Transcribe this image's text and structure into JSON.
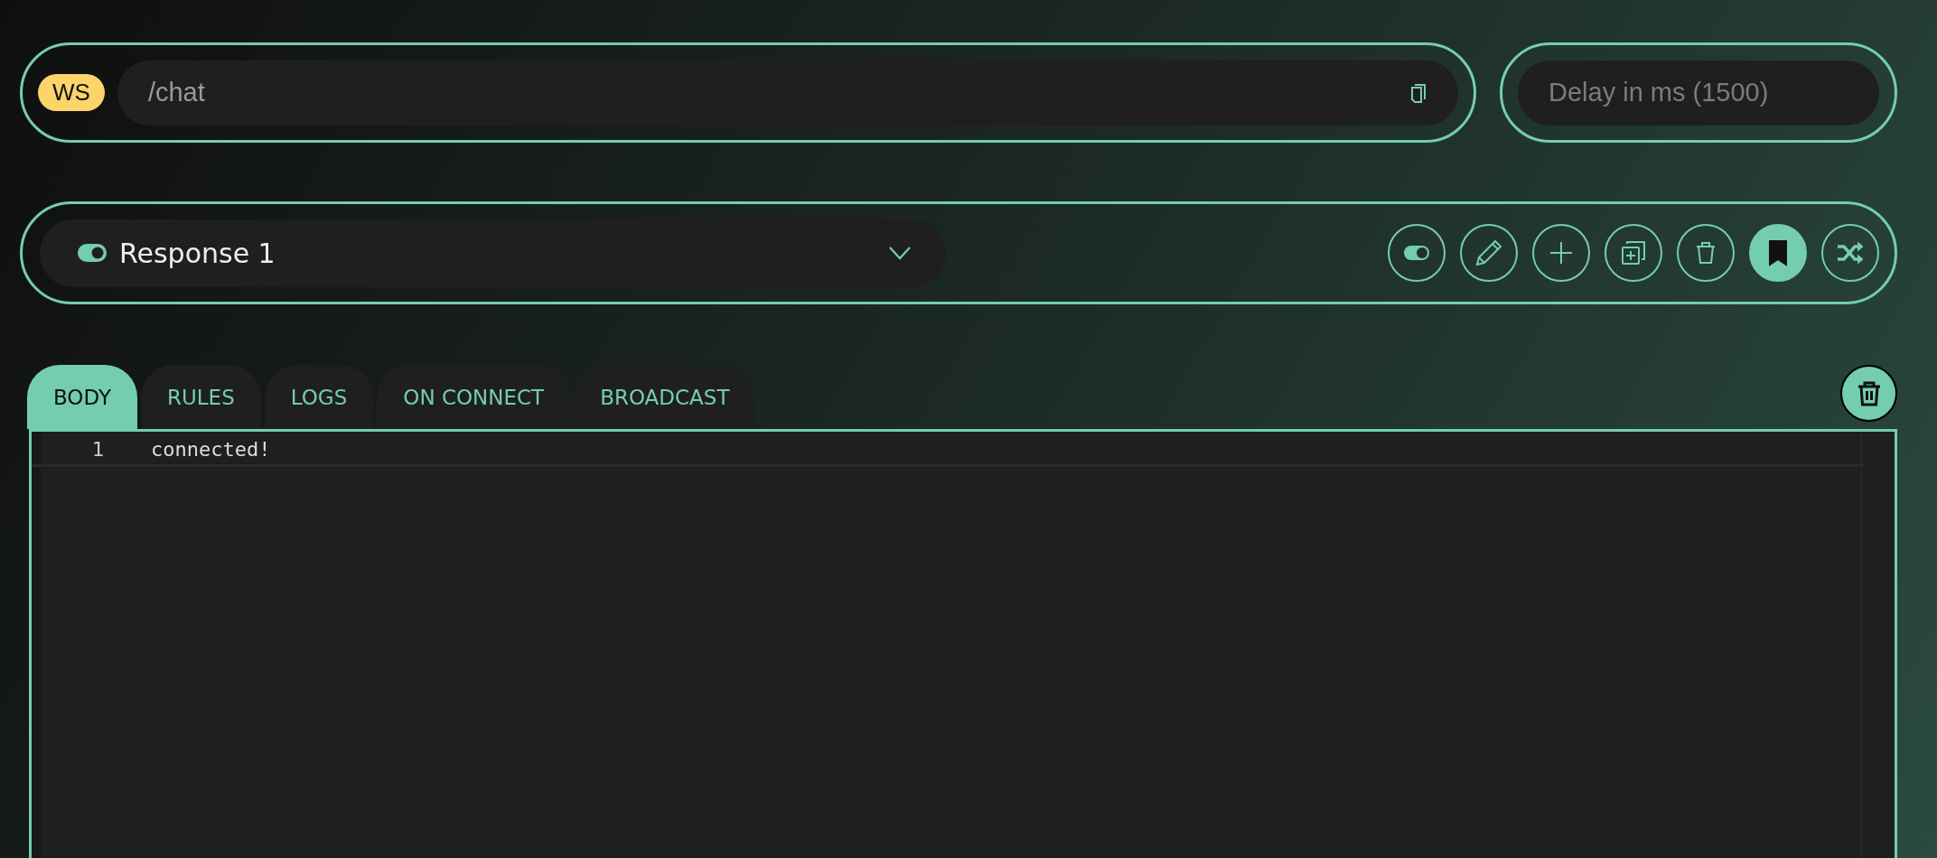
{
  "endpoint": {
    "protocol": "WS",
    "path": "/chat"
  },
  "delay": {
    "placeholder": "Delay in ms (1500)"
  },
  "response": {
    "label": "Response 1",
    "enabled": true
  },
  "actions": [
    {
      "kind": "toggle",
      "active": false
    },
    {
      "kind": "edit",
      "active": false
    },
    {
      "kind": "add",
      "active": false
    },
    {
      "kind": "duplicate",
      "active": false
    },
    {
      "kind": "delete",
      "active": false
    },
    {
      "kind": "bookmark",
      "active": true
    },
    {
      "kind": "shuffle",
      "active": false
    }
  ],
  "tabs": [
    {
      "label": "BODY",
      "selected": true
    },
    {
      "label": "RULES",
      "selected": false
    },
    {
      "label": "LOGS",
      "selected": false
    },
    {
      "label": "ON CONNECT",
      "selected": false
    },
    {
      "label": "BROADCAST",
      "selected": false
    }
  ],
  "editor": {
    "lines": [
      {
        "number": "1",
        "text": "connected!"
      }
    ]
  }
}
